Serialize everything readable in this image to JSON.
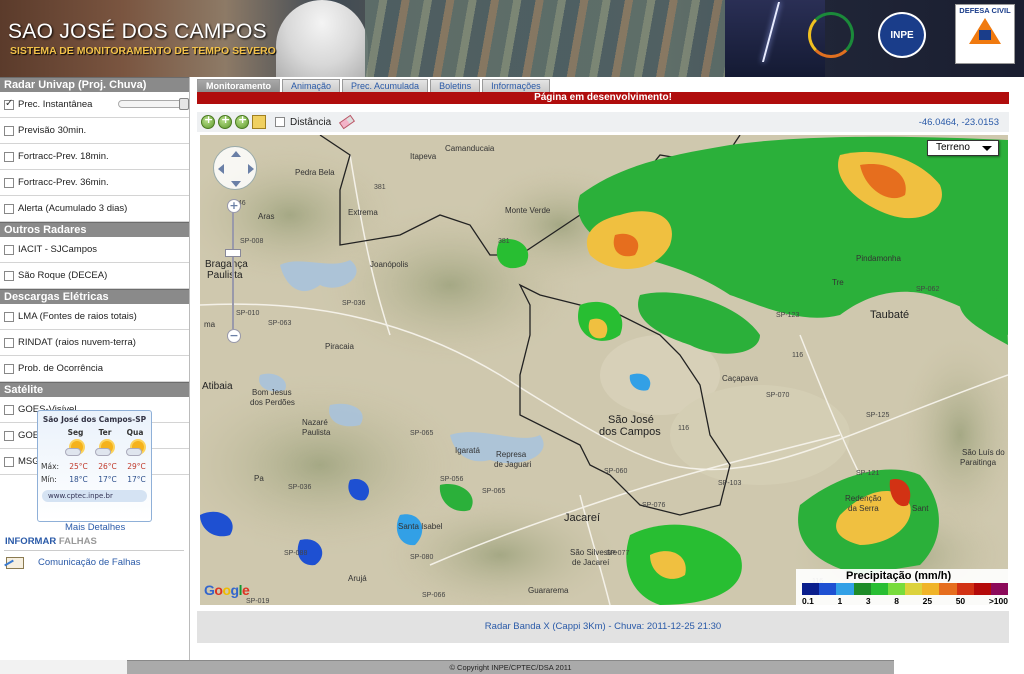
{
  "header": {
    "title": "SAO JOSÉ DOS CAMPOS",
    "subtitle": "SISTEMA DE MONITORAMENTO DE TEMPO SEVERO",
    "logos": [
      "univap-logo",
      "inpe-logo",
      "defesa-civil-logo"
    ],
    "inpe_text": "INPE",
    "defesa_text": "DEFESA CIVIL"
  },
  "sidebar": {
    "sections": [
      {
        "title": "Radar Univap (Proj. Chuva)",
        "items": [
          {
            "label": "Prec. Instantânea",
            "checked": true
          },
          {
            "label": "Previsão 30min.",
            "checked": false
          },
          {
            "label": "Fortracc-Prev. 18min.",
            "checked": false
          },
          {
            "label": "Fortracc-Prev. 36min.",
            "checked": false
          },
          {
            "label": "Alerta (Acumulado 3 dias)",
            "checked": false
          }
        ]
      },
      {
        "title": "Outros Radares",
        "items": [
          {
            "label": "IACIT - SJCampos",
            "checked": false
          },
          {
            "label": "São Roque (DECEA)",
            "checked": false
          }
        ]
      },
      {
        "title": "Descargas Elétricas",
        "items": [
          {
            "label": "LMA (Fontes de raios totais)",
            "checked": false
          },
          {
            "label": "RINDAT (raios nuvem-terra)",
            "checked": false
          },
          {
            "label": "Prob. de Ocorrência",
            "checked": false
          }
        ]
      },
      {
        "title": "Satélite",
        "items": [
          {
            "label": "GOES-Visível",
            "checked": false
          },
          {
            "label": "GOES-Infra",
            "checked": false
          },
          {
            "label": "MSG-Infra",
            "checked": false
          }
        ]
      }
    ],
    "opacity_slider": 1.0
  },
  "weather": {
    "title": "São José dos Campos-SP",
    "days": [
      "Seg",
      "Ter",
      "Qua"
    ],
    "max_label": "Máx:",
    "min_label": "Mín:",
    "max": [
      "25°C",
      "26°C",
      "29°C"
    ],
    "min": [
      "18°C",
      "17°C",
      "17°C"
    ],
    "url": "www.cptec.inpe.br",
    "more": "Mais Detalhes"
  },
  "inform": {
    "label_a": "INFORMAR",
    "label_b": "FALHAS",
    "report": "Comunicação de Falhas"
  },
  "tabs": [
    "Monitoramento",
    "Animação",
    "Prec. Acumulada",
    "Boletins",
    "Informações"
  ],
  "active_tab": 0,
  "notice": "Página em desenvolvimento!",
  "toolbar": {
    "distance_label": "Distância",
    "coords": "-46.0464, -23.0153"
  },
  "map": {
    "terrain": "Terreno",
    "places": {
      "camanducaia": "Camanducaia",
      "itapeva": "Itapeva",
      "pedra_bela": "Pedra Bela",
      "extrema": "Extrema",
      "monte_verde": "Monte Verde",
      "braganca1": "Bragança",
      "braganca2": "Paulista",
      "joanopolis": "Joanópolis",
      "piracaia": "Piracaia",
      "atibaia": "Atibaia",
      "bom_jesus1": "Bom Jesus",
      "bom_jesus2": "dos Perdões",
      "nazare1": "Nazaré",
      "nazare2": "Paulista",
      "igarata": "Igaratá",
      "represa1": "Represa",
      "represa2": "de Jaguari",
      "sjc1": "São José",
      "sjc2": "dos Campos",
      "jacarei": "Jacareí",
      "cacapava": "Caçapava",
      "taubate": "Taubaté",
      "pindamonhangaba": "Pindamonha",
      "sao_silvestre1": "São Silvestre",
      "sao_silvestre2": "de Jacareí",
      "aruja": "Arujá",
      "guararema": "Guararema",
      "sao_luis1": "São Luís do",
      "sao_luis2": "Paraitinga",
      "redencao1": "Redenção",
      "redencao2": "da Serra",
      "santa_isabel": "Santa Isabel",
      "aras": "Aras",
      "pa": "Pa",
      "ma": "ma",
      "tre": "Tre",
      "sant": "Sant"
    },
    "roads": [
      "381",
      "381",
      "146",
      "SP-008",
      "SP-010",
      "SP-036",
      "SP-063",
      "SP-065",
      "SP-065",
      "SP-036",
      "SP-056",
      "SP-060",
      "SP-076",
      "SP-077",
      "SP-080",
      "SP-088",
      "SP-066",
      "SP-019",
      "SP-103",
      "SP-070",
      "SP-123",
      "SP-125",
      "SP-121",
      "SP-062",
      "116",
      "116",
      "116"
    ]
  },
  "legend": {
    "title": "Precipitação (mm/h)",
    "ticks": [
      "0.1",
      "1",
      "3",
      "8",
      "25",
      "50",
      ">100"
    ],
    "colors": [
      "#0a1e8c",
      "#1e50d2",
      "#32a0e6",
      "#1e8c28",
      "#28be32",
      "#78dc3c",
      "#dcd23c",
      "#f0b428",
      "#e66e1e",
      "#d23214",
      "#b40a0a",
      "#8c0a5a"
    ]
  },
  "caption": "Radar Banda X (Cappi 3Km) - Chuva: 2011-12-25 21:30",
  "footer": "© Copyright INPE/CPTEC/DSA 2011"
}
